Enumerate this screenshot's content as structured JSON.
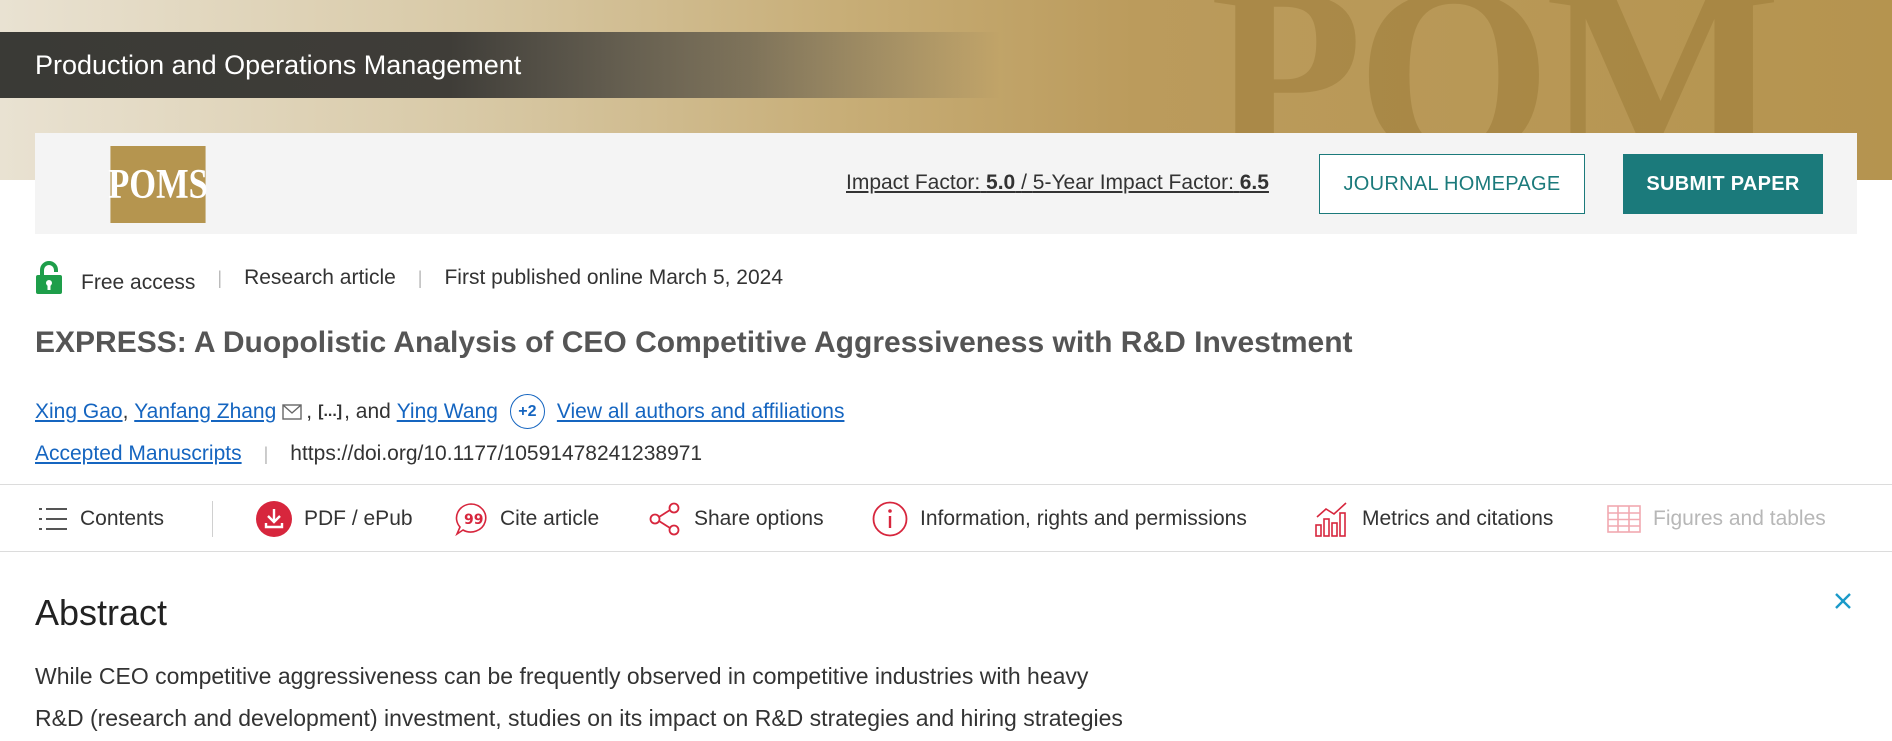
{
  "hero": {
    "journal_name": "Production and Operations Management",
    "watermark": "POM"
  },
  "toolbar": {
    "logo_text": "POMS",
    "impact_factor_label": "Impact Factor:",
    "impact_factor_value": "5.0",
    "five_year_label": "5-Year Impact Factor:",
    "five_year_value": "6.5",
    "journal_homepage_label": "JOURNAL HOMEPAGE",
    "submit_paper_label": "SUBMIT PAPER"
  },
  "meta": {
    "access": "Free access",
    "article_type": "Research article",
    "published": "First published online March 5, 2024"
  },
  "article": {
    "title": "EXPRESS: A Duopolistic Analysis of CEO Competitive Aggressiveness with R&D Investment"
  },
  "authors": {
    "list": [
      "Xing Gao",
      "Yanfang Zhang",
      "Ying Wang"
    ],
    "ellipsis": "[...]",
    "and_text": ", and",
    "more_count": "+2",
    "view_all_label": "View all authors and affiliations"
  },
  "doi": {
    "collection_label": "Accepted Manuscripts",
    "url": "https://doi.org/10.1177/10591478241238971"
  },
  "tabs": [
    {
      "label": "Contents",
      "icon": "list-icon"
    },
    {
      "label": "PDF / ePub",
      "icon": "download-icon"
    },
    {
      "label": "Cite article",
      "icon": "quote-icon"
    },
    {
      "label": "Share options",
      "icon": "share-icon"
    },
    {
      "label": "Information, rights and permissions",
      "icon": "info-icon"
    },
    {
      "label": "Metrics and citations",
      "icon": "bar-chart-icon"
    },
    {
      "label": "Figures and tables",
      "icon": "table-icon",
      "disabled": true
    }
  ],
  "abstract": {
    "heading": "Abstract",
    "line1": "While CEO competitive aggressiveness can be frequently observed in competitive industries with heavy",
    "line2": "R&D (research and development) investment, studies on its impact on R&D strategies and hiring strategies"
  },
  "colors": {
    "teal": "#1b7a7b",
    "link": "#1565c0",
    "accent_red": "#d7263d",
    "gold": "#b5954f",
    "lock_green": "#1e9e4a"
  }
}
